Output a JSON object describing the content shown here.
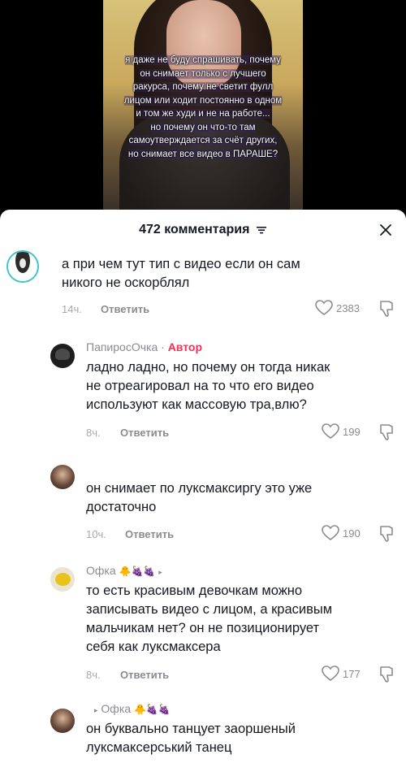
{
  "video": {
    "overlay_lines": [
      "я даже не буду спрашивать, почему",
      "он снимает только с лучшего",
      "ракурса, почему не светит фулл",
      "лицом или ходит постоянно в одном",
      "и том же худи и не на работе...",
      "но почему он что-то там",
      "самоутверждается за счёт других,",
      "но снимает все видео в ПАРАШЕ?"
    ]
  },
  "header": {
    "title": "472 комментария"
  },
  "comments": [
    {
      "text_line1": "а при чем тут тип с видео если он сам",
      "text_line2": "никого не оскорблял",
      "time": "14ч.",
      "reply": "Ответить",
      "likes": "2383"
    },
    {
      "username": "ПапиросОчка",
      "sep": " · ",
      "author": "Автор",
      "text_line1": "ладно ладно, но почему он тогда никак",
      "text_line2": "не отреагировал на то что его видео",
      "text_line3": "используют как массовую тра,влю?",
      "time": "8ч.",
      "reply": "Ответить",
      "likes": "199"
    },
    {
      "text_line1": "он снимает по луксмаксиргу это уже",
      "text_line2": "достаточно",
      "time": "10ч.",
      "reply": "Ответить",
      "likes": "190"
    },
    {
      "username": "Офка",
      "emojis": "🐥🍇🍇",
      "text_line1": "то есть красивым девочкам можно",
      "text_line2": "записывать видео с лицом, а красивым",
      "text_line3": "мальчикам нет? он не позиционирует",
      "text_line4": "себя как луксмаксера",
      "time": "8ч.",
      "reply": "Ответить",
      "likes": "177"
    },
    {
      "reply_to": "Офка",
      "emojis": "🐥🍇🍇",
      "text_line1": "он буквально танцует заоршеный",
      "text_line2": "луксмаксерський танец"
    }
  ],
  "colors": {
    "accent": "#fe2c55",
    "text": "#161823",
    "muted": "#8a8b91"
  }
}
